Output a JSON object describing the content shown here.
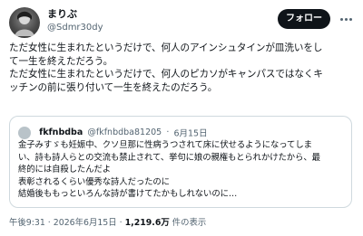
{
  "author": {
    "display_name": "まりぶ",
    "handle": "@Sdmr30dy",
    "follow_label": "フォロー"
  },
  "post": {
    "lines": [
      "ただ女性に生まれたというだけで、何人のアインシュタインが皿洗いをし",
      "て一生を終えただろう。",
      "ただ女性に生まれたというだけで、何人のピカソがキャンパスではなくキ",
      "ッチンの前に張り付いて一生を終えたのだろう。"
    ]
  },
  "quoted": {
    "display_name": "fkfnbdba",
    "handle": "@fkfnbdba81205",
    "separator": "·",
    "date": "6月15日",
    "lines": [
      "金子みすゞも妊娠中、クソ旦那に性病うつされて床に伏せるようになってしま",
      "い、詩も詩人らとの交流も禁止されて、挙句に娘の親権もとられかけたから、最",
      "終的には自殺したんだよ",
      "表彰されるくらい優秀な詩人だったのに",
      "結婚後ももっといろんな詩が書けてたかもしれないのに…"
    ]
  },
  "meta": {
    "time": "午後9:31",
    "separator": "·",
    "date": "2026年6月15日",
    "views_count": "1,219.6万",
    "views_label": "件の表示"
  }
}
